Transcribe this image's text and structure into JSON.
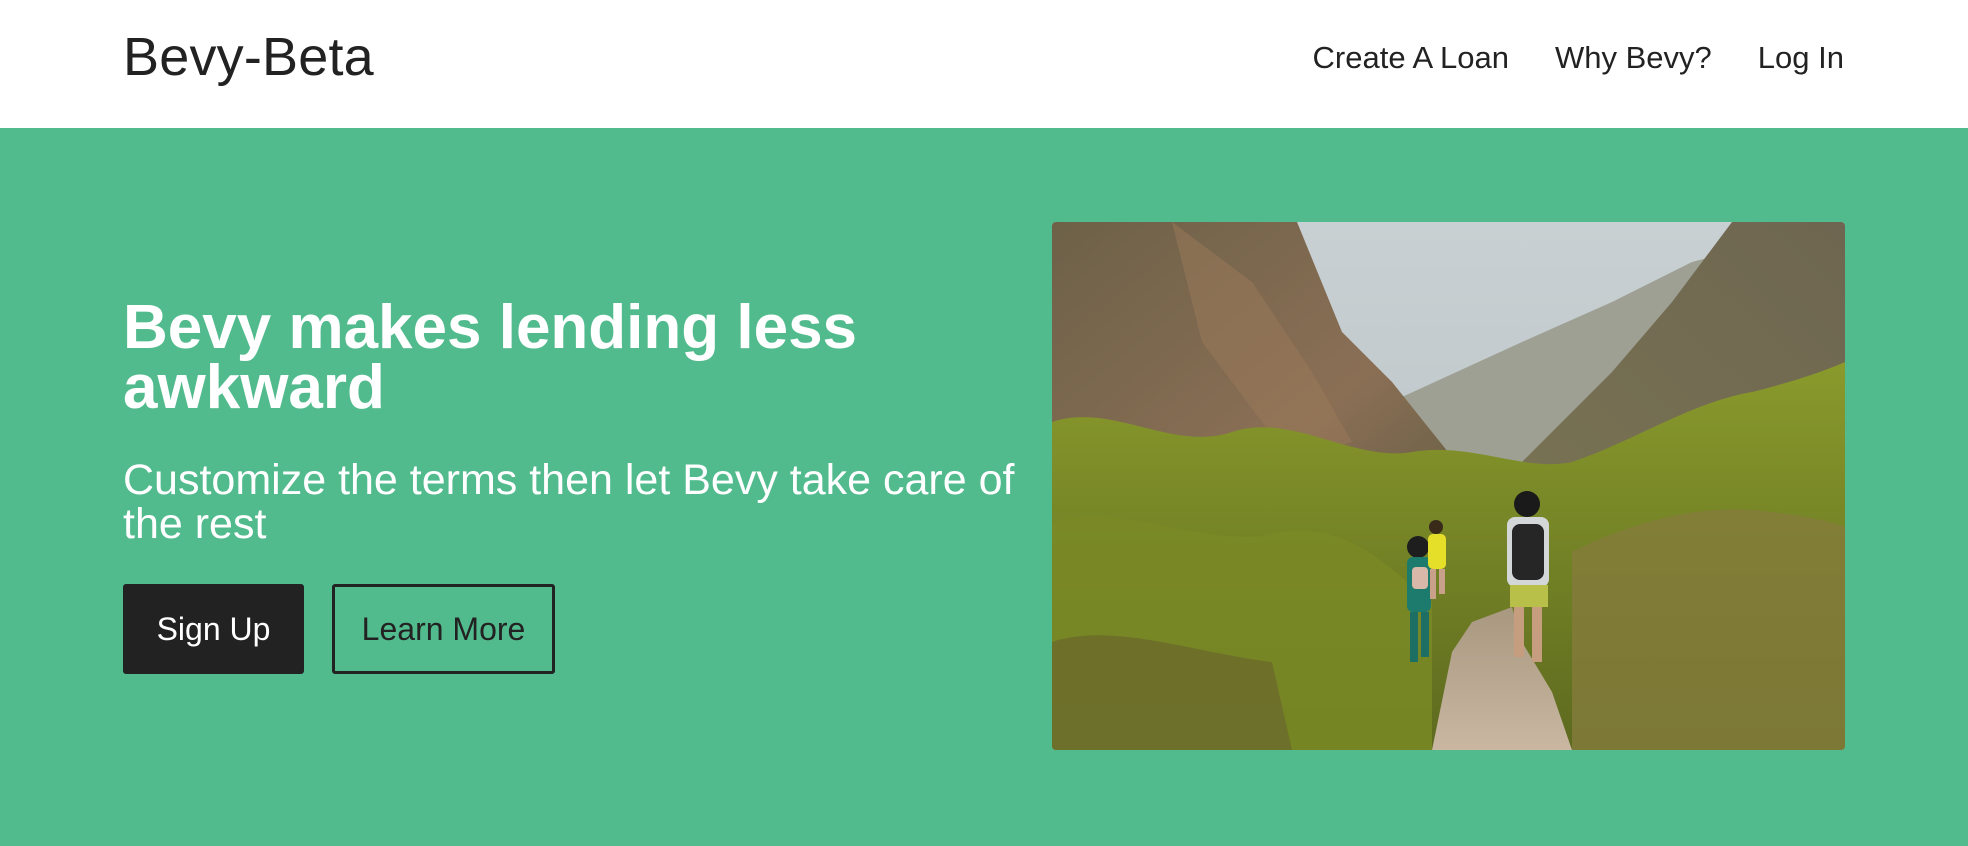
{
  "nav": {
    "brand": "Bevy-Beta",
    "links": [
      "Create A Loan",
      "Why Bevy?",
      "Log In"
    ]
  },
  "hero": {
    "title": "Bevy makes lending less awkward",
    "subtitle": "Customize the terms then let Bevy take care of the rest",
    "signup_label": "Sign Up",
    "learn_more_label": "Learn More",
    "image_icon": "hikers-in-canyon-photo"
  },
  "colors": {
    "hero_background": "#52bb8e",
    "primary_button": "#222222",
    "text_dark": "#222222",
    "text_light": "#ffffff"
  }
}
